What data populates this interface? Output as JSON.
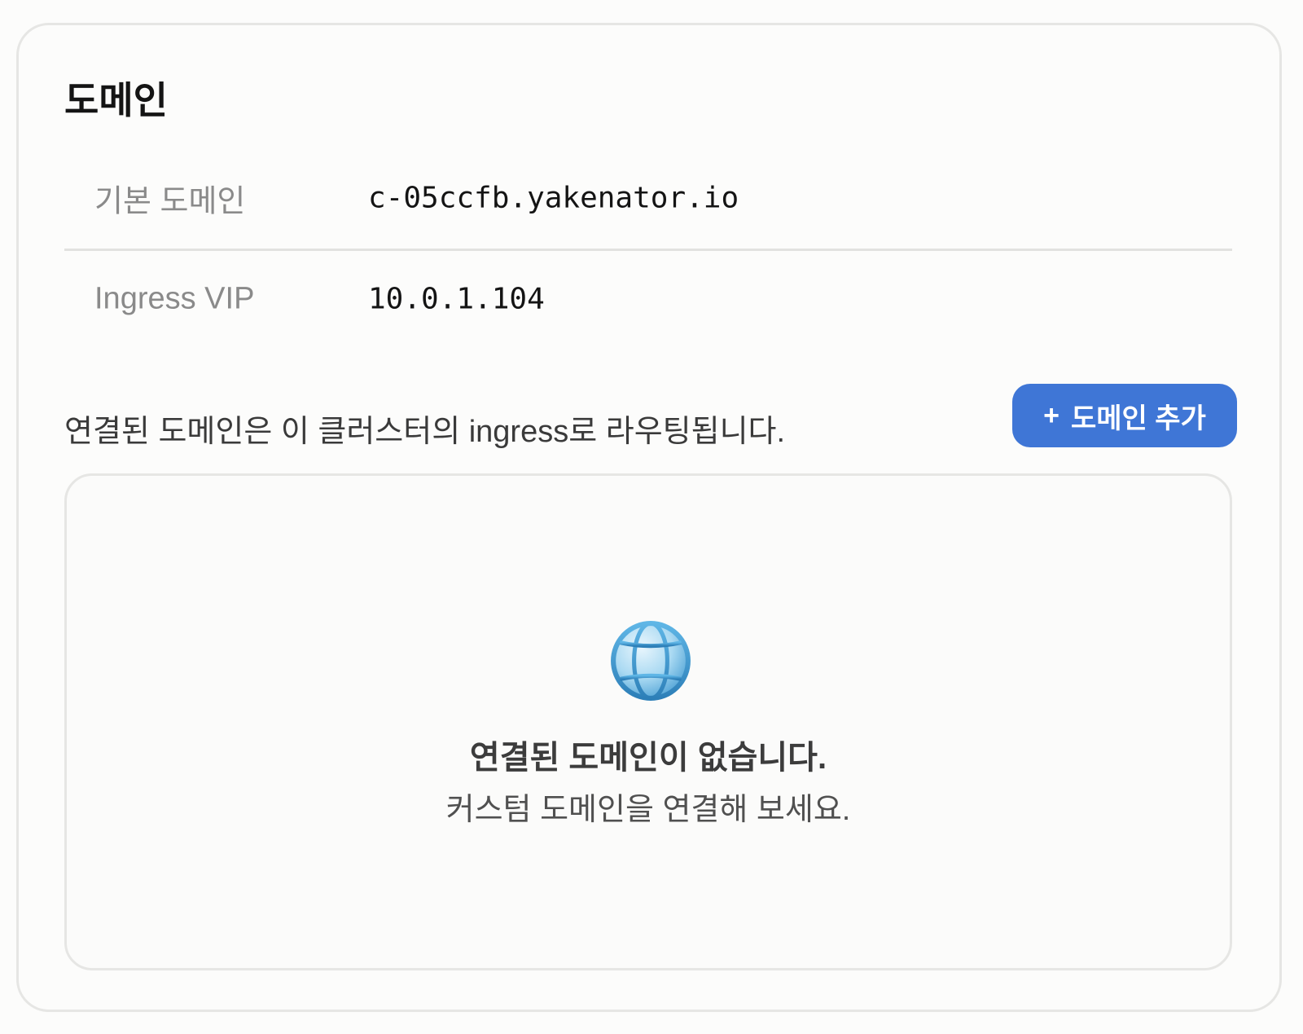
{
  "section": {
    "title": "도메인"
  },
  "info": {
    "default_domain_label": "기본 도메인",
    "default_domain_value": "c-05ccfb.yakenator.io",
    "ingress_vip_label": "Ingress VIP",
    "ingress_vip_value": "10.0.1.104"
  },
  "description": "연결된 도메인은 이 클러스터의 ingress로 라우팅됩니다.",
  "add_button": {
    "icon": "plus-icon",
    "plus": "+",
    "label": "도메인 추가",
    "color": "#3f76d6"
  },
  "empty_state": {
    "icon": "globe-icon",
    "title": "연결된 도메인이 없습니다.",
    "subtitle": "커스텀 도메인을 연결해 보세요."
  }
}
